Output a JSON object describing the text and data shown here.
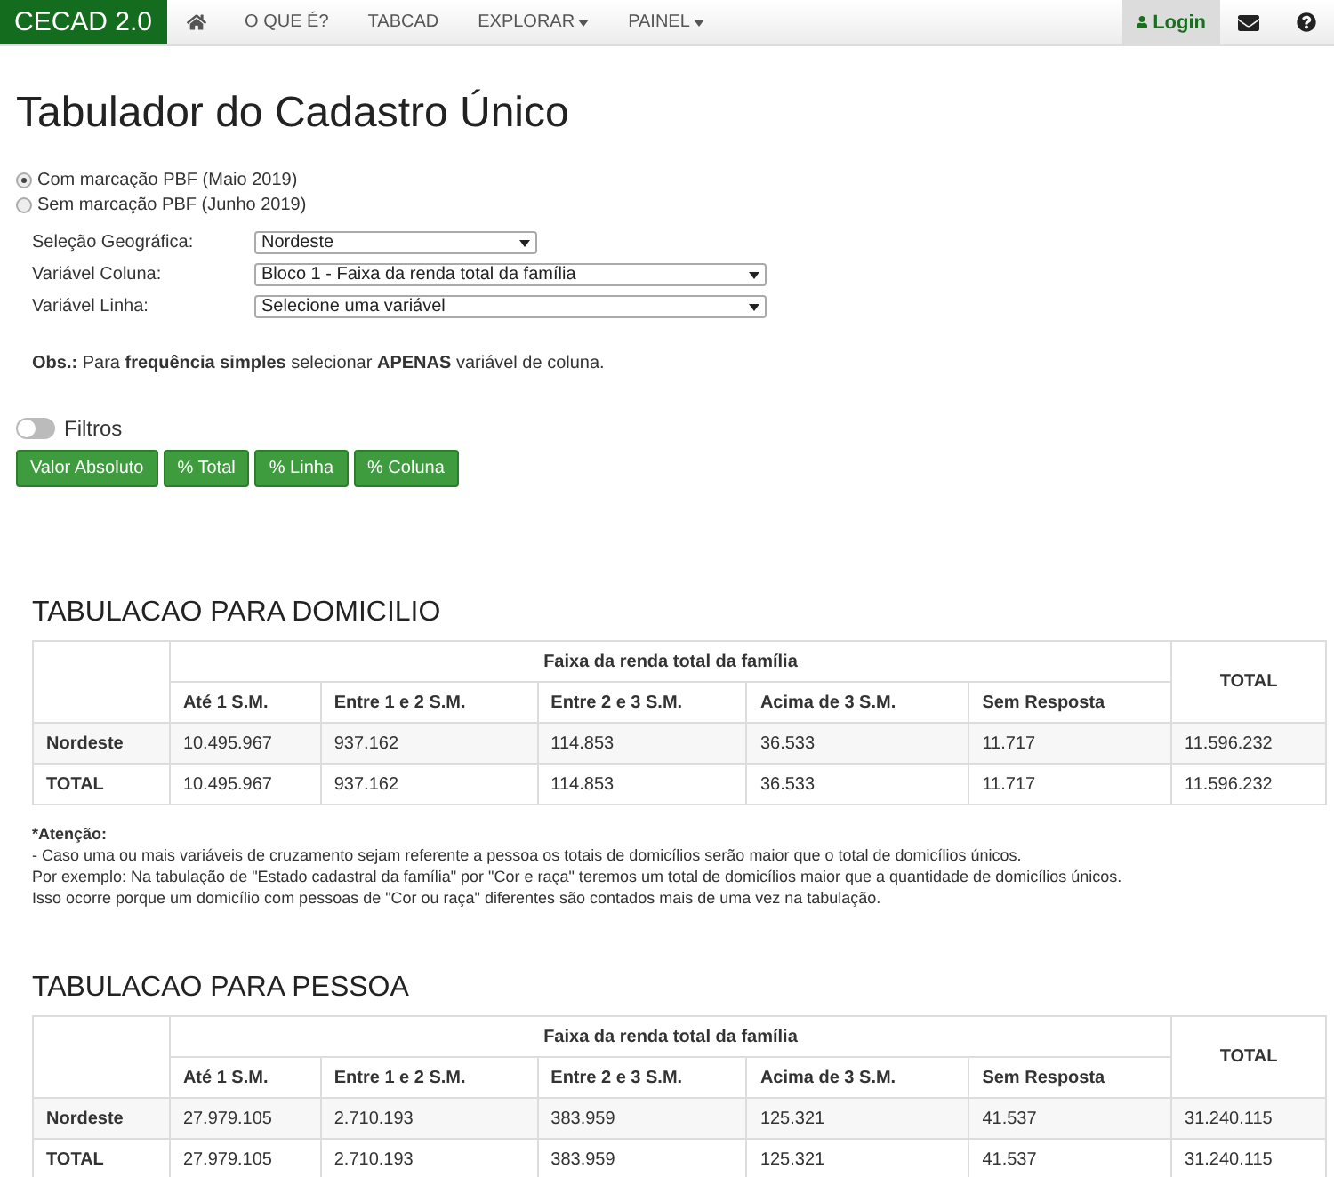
{
  "navbar": {
    "brand": "CECAD 2.0",
    "items": [
      {
        "kind": "home"
      },
      {
        "kind": "link",
        "label": "O QUE É?"
      },
      {
        "kind": "link",
        "label": "TABCAD"
      },
      {
        "kind": "dropdown",
        "label": "EXPLORAR"
      },
      {
        "kind": "dropdown",
        "label": "PAINEL"
      }
    ],
    "right": [
      {
        "kind": "login",
        "label": "Login"
      },
      {
        "kind": "mail"
      },
      {
        "kind": "help"
      }
    ]
  },
  "title": "Tabulador do Cadastro Único",
  "radios": [
    {
      "label": "Com marcação PBF (Maio 2019)",
      "selected": true
    },
    {
      "label": "Sem marcação PBF (Junho 2019)",
      "selected": false
    }
  ],
  "selects": [
    {
      "label": "Seleção Geográfica:",
      "value": "Nordeste"
    },
    {
      "label": "Variável Coluna:",
      "value": "Bloco 1 - Faixa da renda total da família"
    },
    {
      "label": "Variável Linha:",
      "value": "Selecione uma variável"
    }
  ],
  "obs": "**Obs.:** Para **frequência simples** selecionar **APENAS** variável de coluna.",
  "filters": {
    "label": "Filtros",
    "on": false
  },
  "buttons": [
    "Valor Absoluto",
    "% Total",
    "% Linha",
    "% Coluna"
  ],
  "tables": [
    {
      "title": "TABULACAO PARA DOMICILIO",
      "group": "Faixa da renda total da família",
      "total_header": "TOTAL",
      "columns": [
        "Até 1 S.M.",
        "Entre 1 e 2 S.M.",
        "Entre 2 e 3 S.M.",
        "Acima de 3 S.M.",
        "Sem Resposta"
      ],
      "rows": [
        {
          "label": "Nordeste",
          "cells": [
            "10.495.967",
            "937.162",
            "114.853",
            "36.533",
            "11.717",
            "11.596.232"
          ]
        },
        {
          "label": "TOTAL",
          "cells": [
            "10.495.967",
            "937.162",
            "114.853",
            "36.533",
            "11.717",
            "11.596.232"
          ]
        }
      ],
      "notes": [
        "*Atenção:",
        "- Caso uma ou mais variáveis de cruzamento sejam referente a pessoa os totais de domicílios serão maior que o total de domicílios únicos.",
        "Por exemplo: Na tabulação de \"Estado cadastral da família\" por \"Cor e raça\" teremos um total de domicílios maior que a quantidade de domicílios únicos.",
        "Isso ocorre porque um domicílio com pessoas de \"Cor ou raça\" diferentes são contados mais de uma vez na tabulação."
      ]
    },
    {
      "title": "TABULACAO PARA PESSOA",
      "group": "Faixa da renda total da família",
      "total_header": "TOTAL",
      "columns": [
        "Até 1 S.M.",
        "Entre 1 e 2 S.M.",
        "Entre 2 e 3 S.M.",
        "Acima de 3 S.M.",
        "Sem Resposta"
      ],
      "rows": [
        {
          "label": "Nordeste",
          "cells": [
            "27.979.105",
            "2.710.193",
            "383.959",
            "125.321",
            "41.537",
            "31.240.115"
          ]
        },
        {
          "label": "TOTAL",
          "cells": [
            "27.979.105",
            "2.710.193",
            "383.959",
            "125.321",
            "41.537",
            "31.240.115"
          ]
        }
      ]
    }
  ]
}
